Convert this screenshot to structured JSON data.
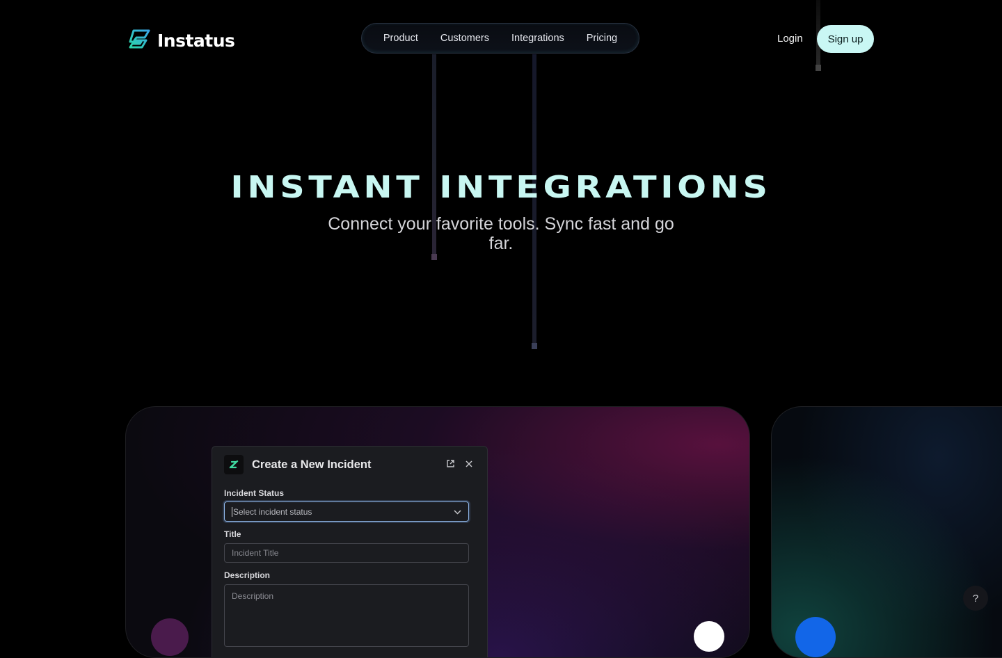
{
  "brand": {
    "name": "Instatus",
    "accent": "#c9f7f4",
    "logo_icon": "instatus-logo-icon"
  },
  "nav": {
    "items": [
      {
        "label": "Product"
      },
      {
        "label": "Customers"
      },
      {
        "label": "Integrations"
      },
      {
        "label": "Pricing"
      }
    ]
  },
  "auth": {
    "login_label": "Login",
    "signup_label": "Sign up"
  },
  "hero": {
    "title": "INSTANT INTEGRATIONS",
    "subtitle": "Connect your favorite tools. Sync fast and go far."
  },
  "incident_modal": {
    "title": "Create a New Incident",
    "icons": [
      "external-link-icon",
      "close-icon"
    ],
    "status_label": "Incident Status",
    "status_placeholder": "Select incident status",
    "title_label": "Title",
    "title_placeholder": "Incident Title",
    "description_label": "Description",
    "description_placeholder": "Description"
  },
  "help": {
    "label": "?"
  }
}
